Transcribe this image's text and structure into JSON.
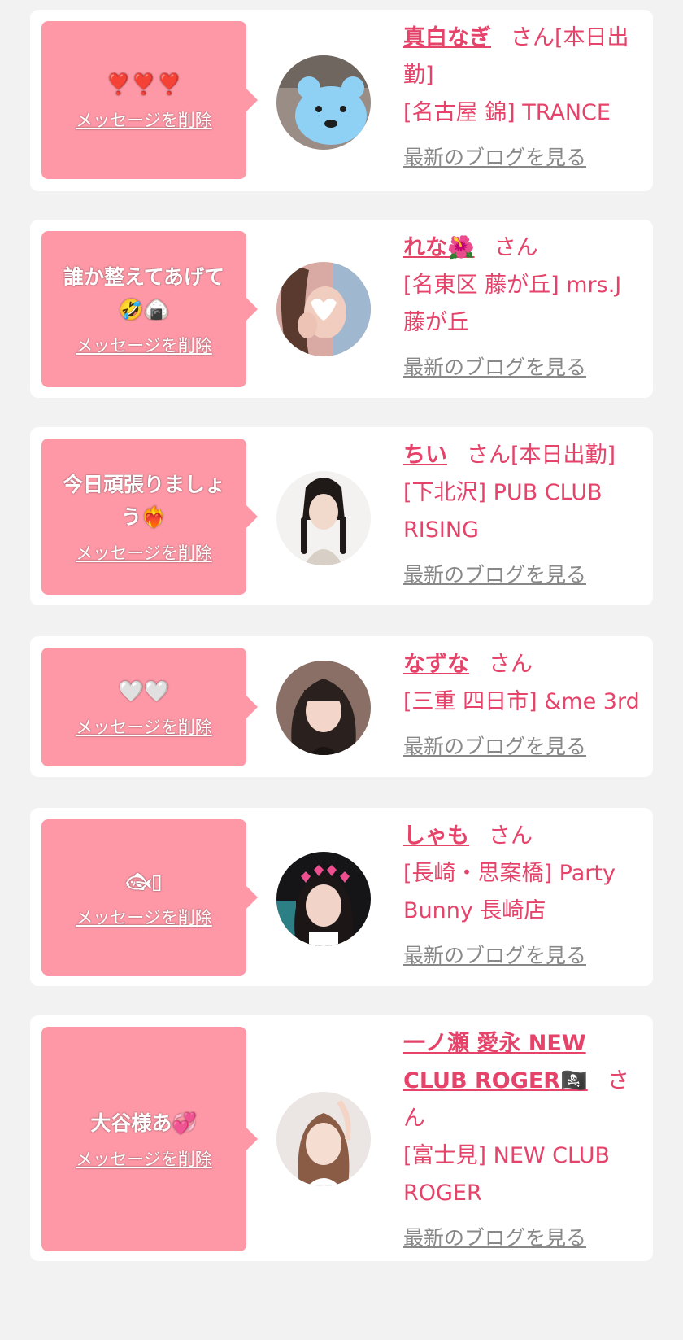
{
  "theme": {
    "accent": "#e5436a",
    "bubble": "#fe98a6",
    "background": "#f2f2f2"
  },
  "delete_label": "メッセージを削除",
  "blog_label": "最新のブログを見る",
  "honorific": "さん",
  "cards": [
    {
      "message": "❣️❣️❣️",
      "name": "真白なぎ",
      "status": "[本日出勤]",
      "shop": "[名古屋 錦] TRANCE",
      "avatar": "avatar-blue-bear-sticker"
    },
    {
      "message": "誰か整えてあげて🤣🍙",
      "name": "れな🌺",
      "status": "",
      "shop": "[名東区 藤が丘] mrs.J 藤が丘",
      "avatar": "avatar-woman-heart-face"
    },
    {
      "message": "今日頑張りましょう❤️‍🔥",
      "name": "ちい",
      "status": "[本日出勤]",
      "shop": "[下北沢] PUB CLUB RISING",
      "avatar": "avatar-woman-braids"
    },
    {
      "message": "🤍🤍",
      "name": "なずな",
      "status": "",
      "shop": "[三重 四日市] &me 3rd",
      "avatar": "avatar-woman-bangs"
    },
    {
      "message": "🐟︎▯",
      "name": "しゃも",
      "status": "",
      "shop": "[長崎・思案橋] Party Bunny 長崎店",
      "avatar": "avatar-woman-heart-crown"
    },
    {
      "message": "大谷様あ💞",
      "name": "一ノ瀬 愛永 NEW CLUB ROGER🏴‍☠️",
      "status": "",
      "shop": "[富士見] NEW CLUB ROGER",
      "avatar": "avatar-woman-arm-raised"
    }
  ]
}
